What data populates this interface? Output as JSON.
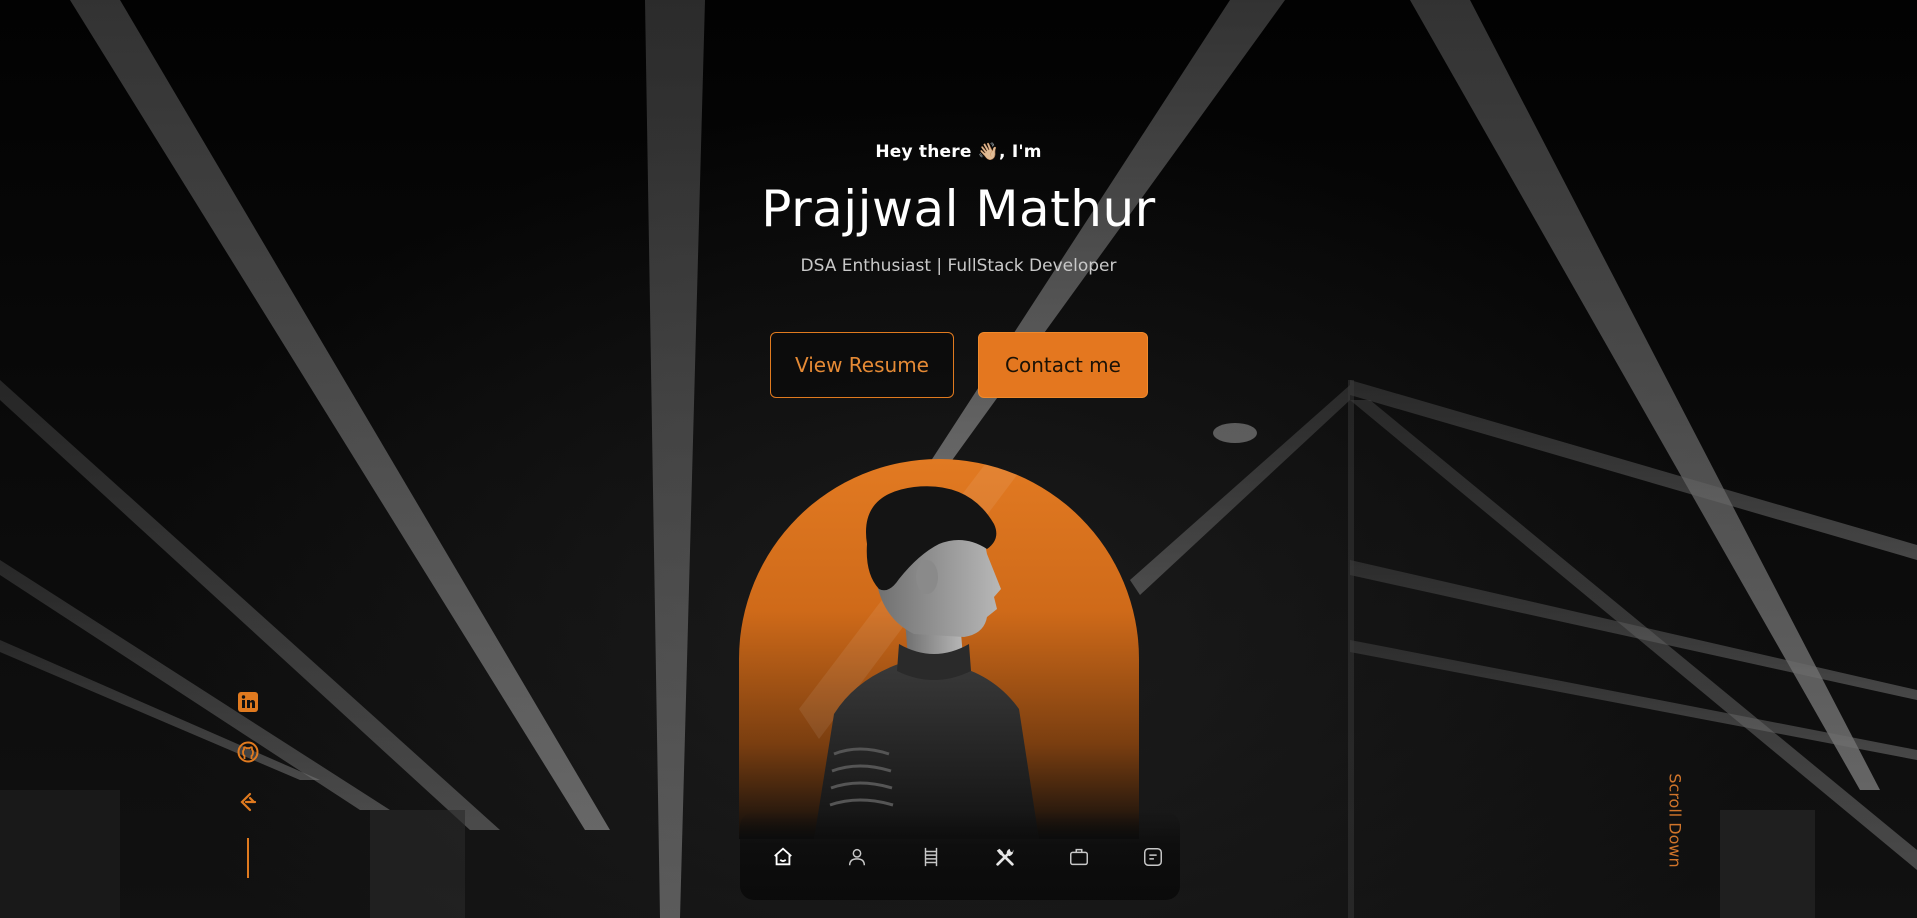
{
  "hero": {
    "greeting": "Hey there 👋🏼, I'm",
    "name": "Prajjwal Mathur",
    "tagline": "DSA Enthusiast | FullStack Developer"
  },
  "actions": {
    "resume_label": "View Resume",
    "contact_label": "Contact me"
  },
  "socials": {
    "items": [
      {
        "icon": "linkedin-icon"
      },
      {
        "icon": "github-icon"
      },
      {
        "icon": "leetcode-icon"
      }
    ]
  },
  "scroll": {
    "label": "Scroll Down"
  },
  "nav": {
    "items": [
      {
        "icon": "home-icon",
        "active": true
      },
      {
        "icon": "user-icon",
        "active": false
      },
      {
        "icon": "ladder-icon",
        "active": false
      },
      {
        "icon": "tools-icon",
        "active": false
      },
      {
        "icon": "briefcase-icon",
        "active": false
      },
      {
        "icon": "message-icon",
        "active": false
      }
    ]
  },
  "colors": {
    "accent": "#e4771f",
    "background": "#050505",
    "text": "#ffffff",
    "muted_text": "#c9c9c9"
  }
}
